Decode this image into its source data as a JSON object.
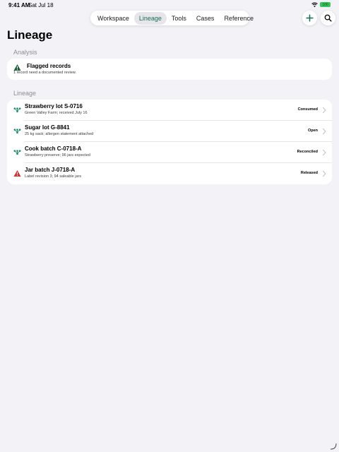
{
  "status": {
    "time": "9:41 AM",
    "date": "Sat Jul 18",
    "battery": "100"
  },
  "nav": {
    "tabs": [
      {
        "label": "Workspace"
      },
      {
        "label": "Lineage"
      },
      {
        "label": "Tools"
      },
      {
        "label": "Cases"
      },
      {
        "label": "Reference"
      }
    ],
    "selected": "Lineage"
  },
  "page": {
    "title": "Lineage"
  },
  "analysis": {
    "header": "Analysis",
    "flagged": {
      "title": "Flagged records",
      "subtitle": "1 record need a documented review."
    }
  },
  "lineage": {
    "header": "Lineage",
    "items": [
      {
        "title": "Strawberry lot S-0716",
        "subtitle": "Green Valley Farm; received July 16",
        "status": "Consumed",
        "icon": "lineage-icon"
      },
      {
        "title": "Sugar lot G-8841",
        "subtitle": "25 kg sack; allergen statement attached",
        "status": "Open",
        "icon": "lineage-icon"
      },
      {
        "title": "Cook batch C-0718-A",
        "subtitle": "Strawberry preserve; 96 jars expected",
        "status": "Reconciled",
        "icon": "lineage-icon"
      },
      {
        "title": "Jar batch J-0718-A",
        "subtitle": "Label revision 3; 94 saleable jars",
        "status": "Released",
        "icon": "warning-icon"
      }
    ]
  },
  "colors": {
    "accent": "#1a6e4f",
    "warning": "#d32f2f",
    "flag": "#1f5e3a"
  }
}
